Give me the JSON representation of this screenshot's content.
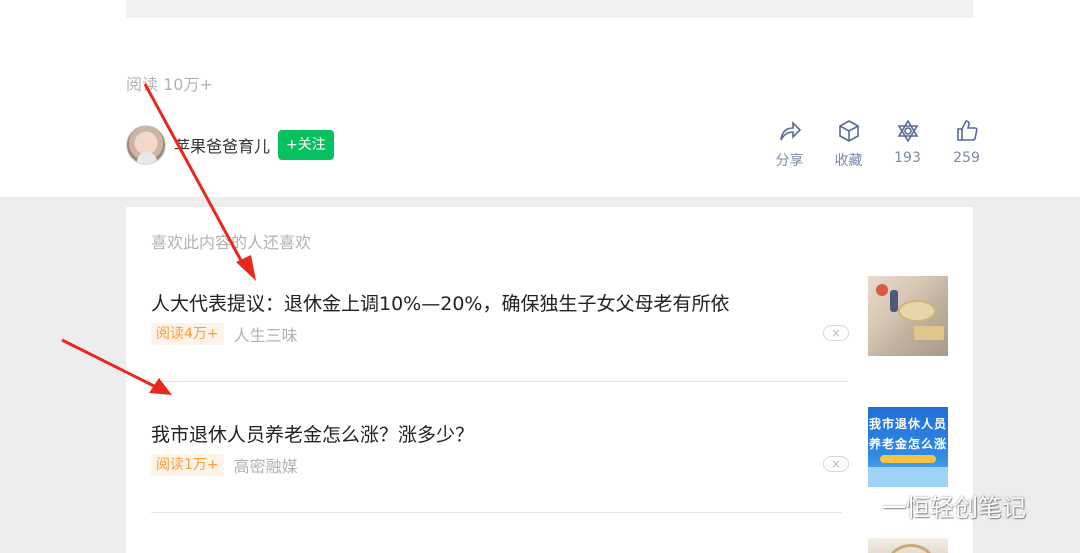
{
  "article": {
    "read_count": "阅读 10万+",
    "author_name": "苹果爸爸育儿",
    "follow_label": "+关注"
  },
  "actions": [
    {
      "icon": "share-icon",
      "label": "分享"
    },
    {
      "icon": "favorite-icon",
      "label": "收藏"
    },
    {
      "icon": "wow-icon",
      "label": "193"
    },
    {
      "icon": "like-icon",
      "label": "259"
    }
  ],
  "recommendations": {
    "title": "喜欢此内容的人还喜欢",
    "items": [
      {
        "headline": "人大代表提议：退休金上调10%—20%，确保独生子女父母老有所依",
        "read_badge": "阅读4万+",
        "source": "人生三味",
        "close": "×"
      },
      {
        "headline": "我市退休人员养老金怎么涨？涨多少？",
        "read_badge": "阅读1万+",
        "source": "高密融媒",
        "close": "×",
        "thumb_line1": "我市退休人员",
        "thumb_line2": "养老金怎么涨"
      }
    ]
  },
  "watermark": "一恒轻创笔记",
  "colors": {
    "follow_green": "#07c160",
    "annotation_red": "#e8281e",
    "badge_orange": "#fa9d3b",
    "link_blue": "#576b95"
  }
}
